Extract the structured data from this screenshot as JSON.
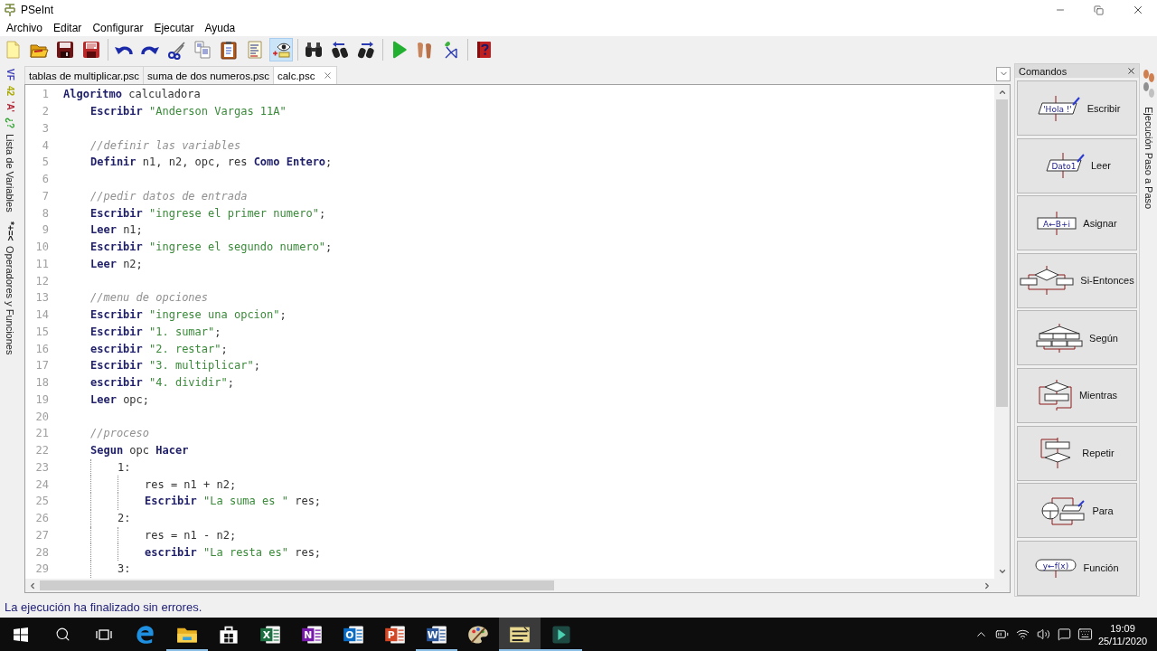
{
  "window": {
    "title": "PSeInt"
  },
  "menu": [
    "Archivo",
    "Editar",
    "Configurar",
    "Ejecutar",
    "Ayuda"
  ],
  "toolbar": [
    [
      {
        "kind": "new",
        "on": false
      },
      {
        "kind": "open",
        "on": false
      },
      {
        "kind": "save",
        "on": false
      },
      {
        "kind": "save-as",
        "on": false
      }
    ],
    [
      {
        "kind": "undo",
        "on": false
      },
      {
        "kind": "redo",
        "on": false
      },
      {
        "kind": "cut",
        "on": false
      },
      {
        "kind": "copy",
        "on": false
      },
      {
        "kind": "paste",
        "on": false
      },
      {
        "kind": "list",
        "on": false
      },
      {
        "kind": "watch",
        "on": true
      }
    ],
    [
      {
        "kind": "find",
        "on": false
      },
      {
        "kind": "find-prev",
        "on": false
      },
      {
        "kind": "find-next",
        "on": false
      }
    ],
    [
      {
        "kind": "run",
        "on": false
      },
      {
        "kind": "step",
        "on": false
      },
      {
        "kind": "diagram",
        "on": false
      }
    ],
    [
      {
        "kind": "help",
        "on": false
      }
    ]
  ],
  "side_tabs": [
    {
      "glyphs": [
        {
          "text": "VF",
          "color": "#3a3ab4"
        },
        {
          "text": "42",
          "color": "#a8a800"
        },
        {
          "text": "'A'",
          "color": "#b02838"
        },
        {
          "text": "¿?",
          "color": "#2ea02e"
        }
      ],
      "label": "Lista de Variables"
    },
    {
      "glyphs": [
        {
          "text": "*+=<",
          "color": "#202020"
        }
      ],
      "label": "Operadores y Funciones"
    }
  ],
  "file_tabs": [
    {
      "label": "tablas de multiplicar.psc",
      "selected": false
    },
    {
      "label": "suma de dos numeros.psc",
      "selected": false
    },
    {
      "label": "calc.psc",
      "selected": true
    }
  ],
  "editor": {
    "lines": [
      {
        "number": "1",
        "tokens": [
          {
            "kind": "keyword",
            "text": "Algoritmo"
          },
          {
            "kind": "plain",
            "text": " calculadora"
          }
        ],
        "children": [
          {
            "number": "2",
            "tokens": [
              {
                "kind": "keyword",
                "text": "Escribir"
              },
              {
                "kind": "string",
                "text": " \"Anderson Vargas 11A\""
              }
            ]
          },
          {
            "number": "3"
          },
          {
            "number": "4",
            "tokens": [
              {
                "kind": "comment",
                "text": "//definir las variables"
              }
            ]
          },
          {
            "number": "5",
            "tokens": [
              {
                "kind": "keyword",
                "text": "Definir"
              },
              {
                "kind": "plain",
                "text": " n1, n2, opc, res "
              },
              {
                "kind": "keyword",
                "text": "Como Entero"
              },
              {
                "kind": "plain",
                "text": ";"
              }
            ]
          },
          {
            "number": "6"
          },
          {
            "number": "7",
            "tokens": [
              {
                "kind": "comment",
                "text": "//pedir datos de entrada"
              }
            ]
          },
          {
            "number": "8",
            "tokens": [
              {
                "kind": "keyword",
                "text": "Escribir"
              },
              {
                "kind": "string",
                "text": " \"ingrese el primer numero\""
              },
              {
                "kind": "plain",
                "text": ";"
              }
            ]
          },
          {
            "number": "9",
            "tokens": [
              {
                "kind": "keyword",
                "text": "Leer"
              },
              {
                "kind": "plain",
                "text": " n1;"
              }
            ]
          },
          {
            "number": "10",
            "tokens": [
              {
                "kind": "keyword",
                "text": "Escribir"
              },
              {
                "kind": "string",
                "text": " \"ingrese el segundo numero\""
              },
              {
                "kind": "plain",
                "text": ";"
              }
            ]
          },
          {
            "number": "11",
            "tokens": [
              {
                "kind": "keyword",
                "text": "Leer"
              },
              {
                "kind": "plain",
                "text": " n2;"
              }
            ]
          },
          {
            "number": "12"
          },
          {
            "number": "13",
            "tokens": [
              {
                "kind": "comment",
                "text": "//menu de opciones"
              }
            ]
          },
          {
            "number": "14",
            "tokens": [
              {
                "kind": "keyword",
                "text": "Escribir"
              },
              {
                "kind": "string",
                "text": " \"ingrese una opcion\""
              },
              {
                "kind": "plain",
                "text": ";"
              }
            ]
          },
          {
            "number": "15",
            "tokens": [
              {
                "kind": "keyword",
                "text": "Escribir"
              },
              {
                "kind": "string",
                "text": " \"1. sumar\""
              },
              {
                "kind": "plain",
                "text": ";"
              }
            ]
          },
          {
            "number": "16",
            "tokens": [
              {
                "kind": "keyword",
                "text": "escribir"
              },
              {
                "kind": "string",
                "text": " \"2. restar\""
              },
              {
                "kind": "plain",
                "text": ";"
              }
            ]
          },
          {
            "number": "17",
            "tokens": [
              {
                "kind": "keyword",
                "text": "Escribir"
              },
              {
                "kind": "string",
                "text": " \"3. multiplicar\""
              },
              {
                "kind": "plain",
                "text": ";"
              }
            ]
          },
          {
            "number": "18",
            "tokens": [
              {
                "kind": "keyword",
                "text": "escribir"
              },
              {
                "kind": "string",
                "text": " \"4. dividir\""
              },
              {
                "kind": "plain",
                "text": ";"
              }
            ]
          },
          {
            "number": "19",
            "tokens": [
              {
                "kind": "keyword",
                "text": "Leer"
              },
              {
                "kind": "plain",
                "text": " opc;"
              }
            ]
          },
          {
            "number": "20"
          },
          {
            "number": "21",
            "tokens": [
              {
                "kind": "comment",
                "text": "//proceso"
              }
            ]
          },
          {
            "number": "22",
            "tokens": [
              {
                "kind": "keyword",
                "text": "Segun"
              },
              {
                "kind": "plain",
                "text": " opc "
              },
              {
                "kind": "keyword",
                "text": "Hacer"
              }
            ],
            "children": [
              {
                "number": "23",
                "tokens": [
                  {
                    "kind": "plain",
                    "text": "1:"
                  }
                ],
                "children": [
                  {
                    "number": "24",
                    "tokens": [
                      {
                        "kind": "plain",
                        "text": "res = n1 + n2;"
                      }
                    ]
                  },
                  {
                    "number": "25",
                    "tokens": [
                      {
                        "kind": "keyword",
                        "text": "Escribir"
                      },
                      {
                        "kind": "string",
                        "text": " \"La suma es \""
                      },
                      {
                        "kind": "plain",
                        "text": " res;"
                      }
                    ]
                  }
                ]
              },
              {
                "number": "26",
                "tokens": [
                  {
                    "kind": "plain",
                    "text": "2:"
                  }
                ],
                "children": [
                  {
                    "number": "27",
                    "tokens": [
                      {
                        "kind": "plain",
                        "text": "res = n1 - n2;"
                      }
                    ]
                  },
                  {
                    "number": "28",
                    "tokens": [
                      {
                        "kind": "keyword",
                        "text": "escribir"
                      },
                      {
                        "kind": "string",
                        "text": " \"La resta es\""
                      },
                      {
                        "kind": "plain",
                        "text": " res;"
                      }
                    ]
                  }
                ]
              },
              {
                "number": "29",
                "tokens": [
                  {
                    "kind": "plain",
                    "text": "3:"
                  }
                ]
              }
            ]
          }
        ]
      }
    ]
  },
  "commands_panel": {
    "title": "Comandos",
    "items": [
      {
        "kind": "escribir",
        "label": "Escribir",
        "icon_text": "'Hola !'"
      },
      {
        "kind": "leer",
        "label": "Leer",
        "icon_text": "Dato1"
      },
      {
        "kind": "asignar",
        "label": "Asignar",
        "icon_text": "A←B+i"
      },
      {
        "kind": "si",
        "label": "Si-Entonces"
      },
      {
        "kind": "segun",
        "label": "Según"
      },
      {
        "kind": "mientras",
        "label": "Mientras"
      },
      {
        "kind": "repetir",
        "label": "Repetir"
      },
      {
        "kind": "para",
        "label": "Para"
      },
      {
        "kind": "funcion",
        "label": "Función",
        "icon_text": "y←f(x)"
      }
    ]
  },
  "side_tab_right": {
    "label": "Ejecución Paso a Paso"
  },
  "status_bar": "La ejecución ha finalizado sin errores.",
  "taskbar": {
    "apps": [
      {
        "kind": "browser",
        "selected": false,
        "running": false
      },
      {
        "kind": "folder",
        "selected": false,
        "running": true
      },
      {
        "kind": "store",
        "selected": false,
        "running": false
      },
      {
        "kind": "sheet",
        "glyph": "X",
        "selected": false,
        "running": false
      },
      {
        "kind": "notes",
        "glyph": "N",
        "selected": false,
        "running": false
      },
      {
        "kind": "mail",
        "glyph": "O",
        "selected": false,
        "running": false
      },
      {
        "kind": "slides",
        "glyph": "P",
        "selected": false,
        "running": false
      },
      {
        "kind": "doc",
        "glyph": "W",
        "selected": false,
        "running": true
      },
      {
        "kind": "paint",
        "selected": false,
        "running": false
      },
      {
        "kind": "pseint",
        "selected": true,
        "running": true
      },
      {
        "kind": "runner",
        "selected": false,
        "running": true
      }
    ],
    "clock": {
      "time": "19:09",
      "date": "25/11/2020"
    }
  }
}
